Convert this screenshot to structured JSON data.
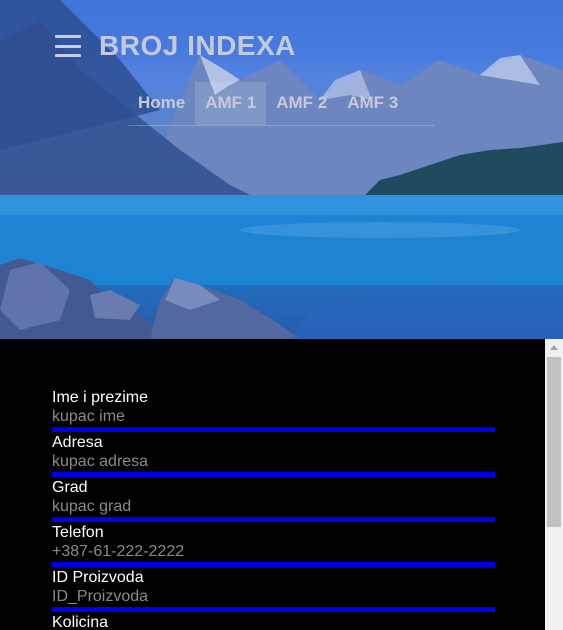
{
  "header": {
    "brand_title": "BROJ INDEXA",
    "menu_icon": "hamburger-menu-icon",
    "nav": [
      {
        "label": "Home",
        "active": false
      },
      {
        "label": "AMF 1",
        "active": true
      },
      {
        "label": "AMF 2",
        "active": false
      },
      {
        "label": "AMF 3",
        "active": false
      }
    ]
  },
  "form": {
    "fields": [
      {
        "label": "Ime i prezime",
        "placeholder": "kupac ime"
      },
      {
        "label": "Adresa",
        "placeholder": "kupac adresa"
      },
      {
        "label": "Grad",
        "placeholder": "kupac grad"
      },
      {
        "label": "Telefon",
        "placeholder": "+387-61-222-2222"
      },
      {
        "label": "ID Proizvoda",
        "placeholder": "ID_Proizvoda"
      },
      {
        "label": "Kolicina",
        "placeholder": ""
      }
    ]
  },
  "colors": {
    "input_underline": "#0000e6",
    "form_background": "#000000"
  }
}
